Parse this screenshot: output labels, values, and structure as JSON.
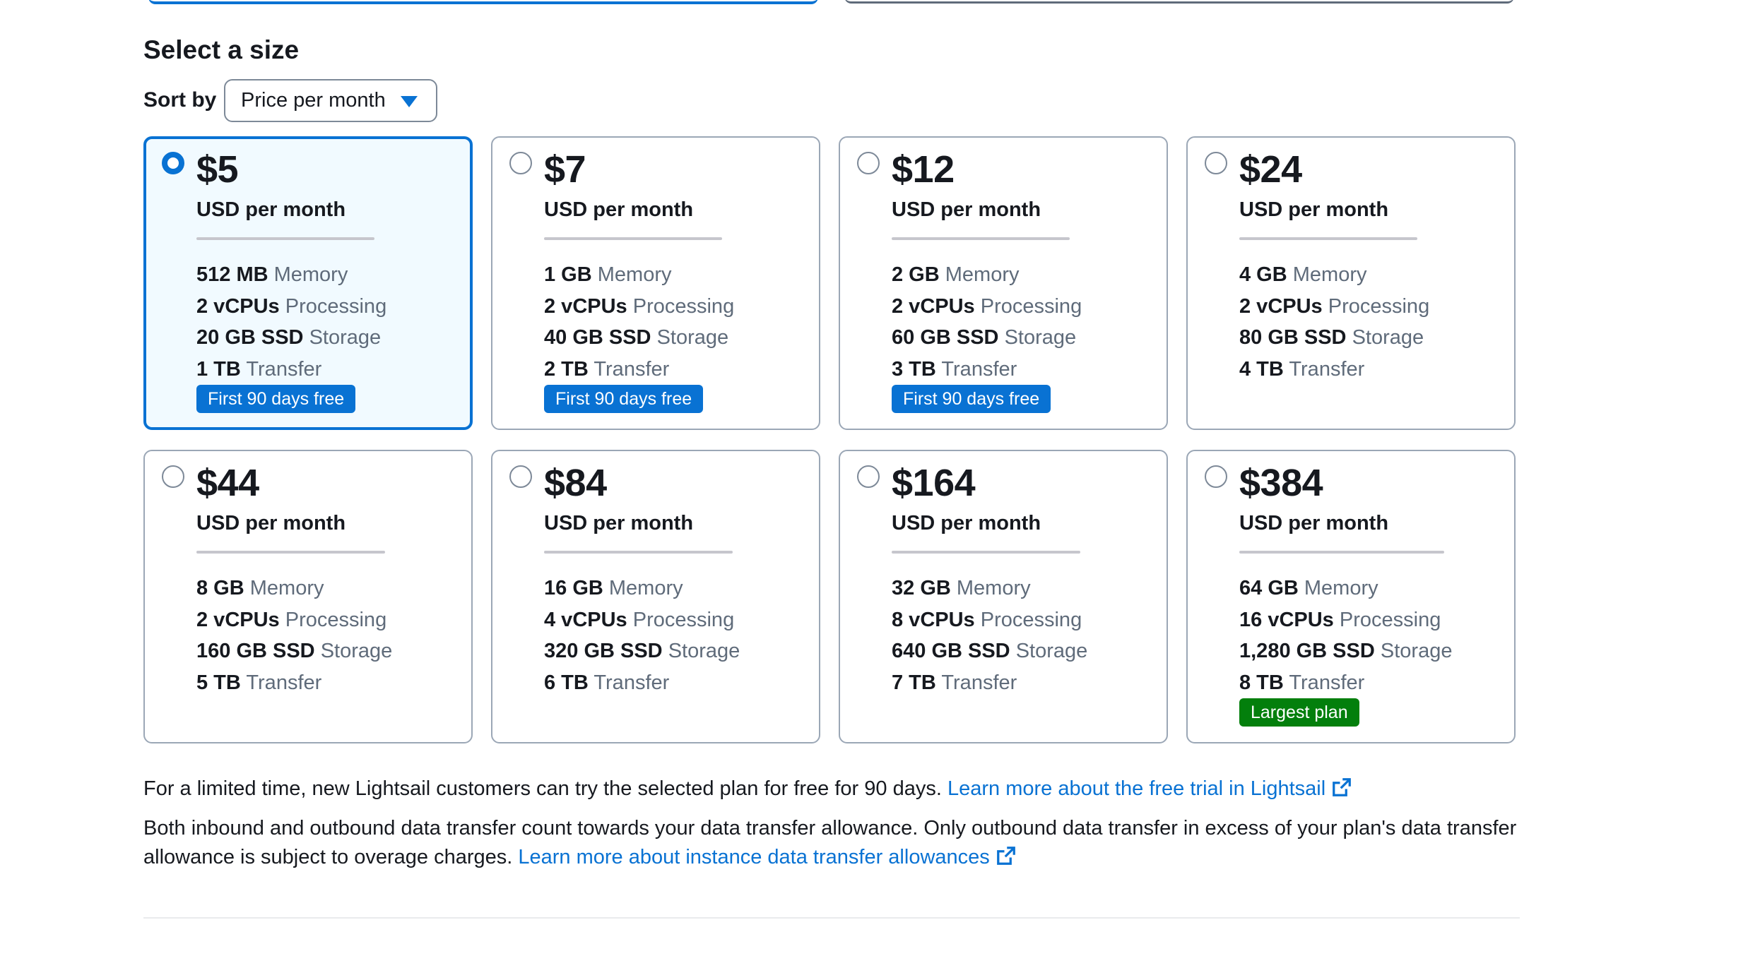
{
  "section_title": "Select a size",
  "sort": {
    "label": "Sort by",
    "selected": "Price per month"
  },
  "plans": [
    {
      "price": "$5",
      "period": "USD per month",
      "memory": "512 MB",
      "memory_unit": "Memory",
      "vcpus": "2 vCPUs",
      "vcpus_unit": "Processing",
      "storage": "20 GB SSD",
      "storage_unit": "Storage",
      "transfer": "1 TB",
      "transfer_unit": "Transfer",
      "badge": "First 90 days free",
      "badge_color": "#0972d3",
      "selected": true
    },
    {
      "price": "$7",
      "period": "USD per month",
      "memory": "1 GB",
      "memory_unit": "Memory",
      "vcpus": "2 vCPUs",
      "vcpus_unit": "Processing",
      "storage": "40 GB SSD",
      "storage_unit": "Storage",
      "transfer": "2 TB",
      "transfer_unit": "Transfer",
      "badge": "First 90 days free",
      "badge_color": "#0972d3",
      "selected": false
    },
    {
      "price": "$12",
      "period": "USD per month",
      "memory": "2 GB",
      "memory_unit": "Memory",
      "vcpus": "2 vCPUs",
      "vcpus_unit": "Processing",
      "storage": "60 GB SSD",
      "storage_unit": "Storage",
      "transfer": "3 TB",
      "transfer_unit": "Transfer",
      "badge": "First 90 days free",
      "badge_color": "#0972d3",
      "selected": false
    },
    {
      "price": "$24",
      "period": "USD per month",
      "memory": "4 GB",
      "memory_unit": "Memory",
      "vcpus": "2 vCPUs",
      "vcpus_unit": "Processing",
      "storage": "80 GB SSD",
      "storage_unit": "Storage",
      "transfer": "4 TB",
      "transfer_unit": "Transfer",
      "badge": "",
      "selected": false
    },
    {
      "price": "$44",
      "period": "USD per month",
      "memory": "8 GB",
      "memory_unit": "Memory",
      "vcpus": "2 vCPUs",
      "vcpus_unit": "Processing",
      "storage": "160 GB SSD",
      "storage_unit": "Storage",
      "transfer": "5 TB",
      "transfer_unit": "Transfer",
      "badge": "",
      "selected": false
    },
    {
      "price": "$84",
      "period": "USD per month",
      "memory": "16 GB",
      "memory_unit": "Memory",
      "vcpus": "4 vCPUs",
      "vcpus_unit": "Processing",
      "storage": "320 GB SSD",
      "storage_unit": "Storage",
      "transfer": "6 TB",
      "transfer_unit": "Transfer",
      "badge": "",
      "selected": false
    },
    {
      "price": "$164",
      "period": "USD per month",
      "memory": "32 GB",
      "memory_unit": "Memory",
      "vcpus": "8 vCPUs",
      "vcpus_unit": "Processing",
      "storage": "640 GB SSD",
      "storage_unit": "Storage",
      "transfer": "7 TB",
      "transfer_unit": "Transfer",
      "badge": "",
      "selected": false
    },
    {
      "price": "$384",
      "period": "USD per month",
      "memory": "64 GB",
      "memory_unit": "Memory",
      "vcpus": "16 vCPUs",
      "vcpus_unit": "Processing",
      "storage": "1,280 GB SSD",
      "storage_unit": "Storage",
      "transfer": "8 TB",
      "transfer_unit": "Transfer",
      "badge": "Largest plan",
      "badge_color": "#037f0c",
      "selected": false
    }
  ],
  "notes": {
    "trial_text": "For a limited time, new Lightsail customers can try the selected plan for free for 90 days.",
    "trial_link": "Learn more about the free trial in Lightsail",
    "transfer_text": "Both inbound and outbound data transfer count towards your data transfer allowance. Only outbound data transfer in excess of your plan's data transfer allowance is subject to overage charges.",
    "transfer_link": "Learn more about instance data transfer allowances"
  },
  "icons": {
    "external_link": "external-link-icon",
    "sort_caret": "caret-down-icon"
  },
  "colors": {
    "accent": "#0972d3",
    "success": "#037f0c",
    "text": "#16191f",
    "muted": "#5f6b7a"
  }
}
